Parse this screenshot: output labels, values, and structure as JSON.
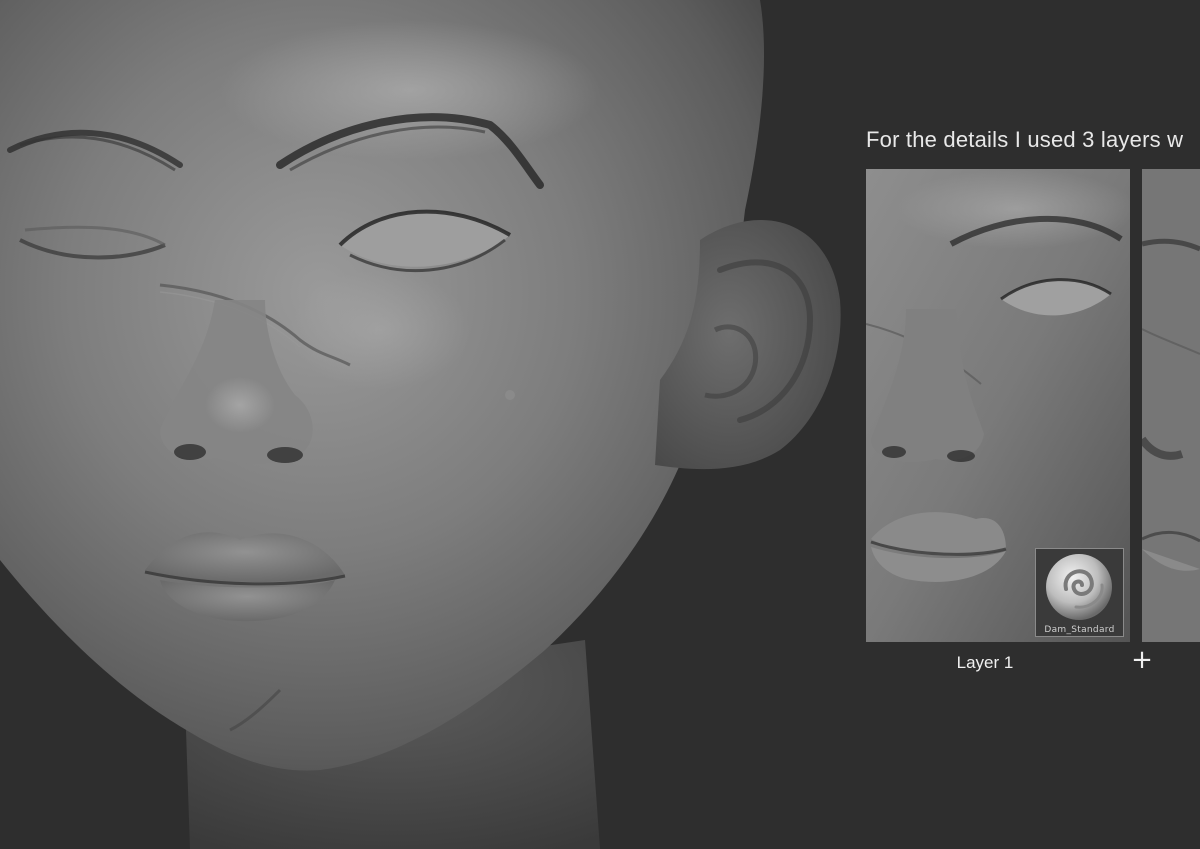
{
  "caption": "For the details I used 3 layers w",
  "panels": [
    {
      "label": "Layer 1",
      "brush": {
        "name": "Dam_Standard",
        "icon": "dam-standard-brush-icon"
      }
    }
  ],
  "separator": "+",
  "colors": {
    "background": "#2e2e2e",
    "clay": "#7a7a7a",
    "text": "#e8e8e8"
  }
}
